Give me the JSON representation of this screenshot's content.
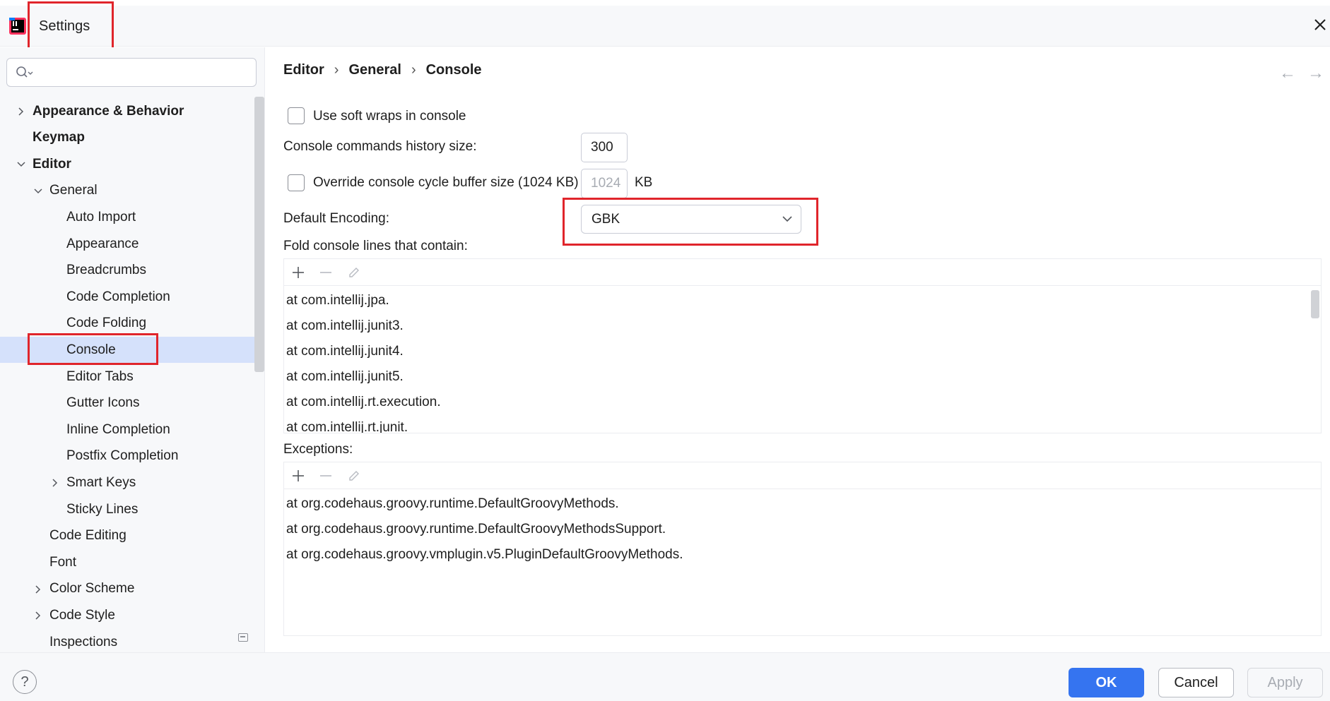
{
  "window": {
    "title": "Settings"
  },
  "search": {
    "placeholder": ""
  },
  "sidebar": {
    "items": [
      {
        "label": "Appearance & Behavior",
        "bold": true,
        "chevron": "right",
        "level": 0
      },
      {
        "label": "Keymap",
        "bold": true,
        "chevron": "",
        "level": 0
      },
      {
        "label": "Editor",
        "bold": true,
        "chevron": "down",
        "level": 0
      },
      {
        "label": "General",
        "bold": false,
        "chevron": "down",
        "level": 1
      },
      {
        "label": "Auto Import",
        "bold": false,
        "chevron": "",
        "level": 2
      },
      {
        "label": "Appearance",
        "bold": false,
        "chevron": "",
        "level": 2
      },
      {
        "label": "Breadcrumbs",
        "bold": false,
        "chevron": "",
        "level": 2
      },
      {
        "label": "Code Completion",
        "bold": false,
        "chevron": "",
        "level": 2
      },
      {
        "label": "Code Folding",
        "bold": false,
        "chevron": "",
        "level": 2
      },
      {
        "label": "Console",
        "bold": false,
        "chevron": "",
        "level": 2,
        "selected": true
      },
      {
        "label": "Editor Tabs",
        "bold": false,
        "chevron": "",
        "level": 2
      },
      {
        "label": "Gutter Icons",
        "bold": false,
        "chevron": "",
        "level": 2
      },
      {
        "label": "Inline Completion",
        "bold": false,
        "chevron": "",
        "level": 2
      },
      {
        "label": "Postfix Completion",
        "bold": false,
        "chevron": "",
        "level": 2
      },
      {
        "label": "Smart Keys",
        "bold": false,
        "chevron": "right",
        "level": 2
      },
      {
        "label": "Sticky Lines",
        "bold": false,
        "chevron": "",
        "level": 2
      },
      {
        "label": "Code Editing",
        "bold": false,
        "chevron": "",
        "level": 1
      },
      {
        "label": "Font",
        "bold": false,
        "chevron": "",
        "level": 1
      },
      {
        "label": "Color Scheme",
        "bold": false,
        "chevron": "right",
        "level": 1
      },
      {
        "label": "Code Style",
        "bold": false,
        "chevron": "right",
        "level": 1
      },
      {
        "label": "Inspections",
        "bold": false,
        "chevron": "",
        "level": 1
      }
    ]
  },
  "breadcrumb": {
    "items": [
      "Editor",
      "General",
      "Console"
    ],
    "separator": "›"
  },
  "nav": {
    "back": "←",
    "forward": "→"
  },
  "settings": {
    "soft_wraps_label": "Use soft wraps in console",
    "soft_wraps_checked": false,
    "history_label": "Console commands history size:",
    "history_value": "300",
    "override_label": "Override console cycle buffer size (1024 KB)",
    "override_checked": false,
    "override_value": "1024",
    "override_unit": "KB",
    "encoding_label": "Default Encoding:",
    "encoding_value": "GBK",
    "fold_label": "Fold console lines that contain:",
    "fold_lines": [
      "at com.intellij.jpa.",
      "at com.intellij.junit3.",
      "at com.intellij.junit4.",
      "at com.intellij.junit5.",
      "at com.intellij.rt.execution.",
      "at com.intellij.rt.junit."
    ],
    "exceptions_label": "Exceptions:",
    "exception_lines": [
      "at org.codehaus.groovy.runtime.DefaultGroovyMethods.",
      "at org.codehaus.groovy.runtime.DefaultGroovyMethodsSupport.",
      "at org.codehaus.groovy.vmplugin.v5.PluginDefaultGroovyMethods."
    ]
  },
  "buttons": {
    "help": "?",
    "ok": "OK",
    "cancel": "Cancel",
    "apply": "Apply"
  },
  "colors": {
    "accent": "#3574f0",
    "highlight": "#e0252b",
    "selection": "#d5e1fb"
  }
}
